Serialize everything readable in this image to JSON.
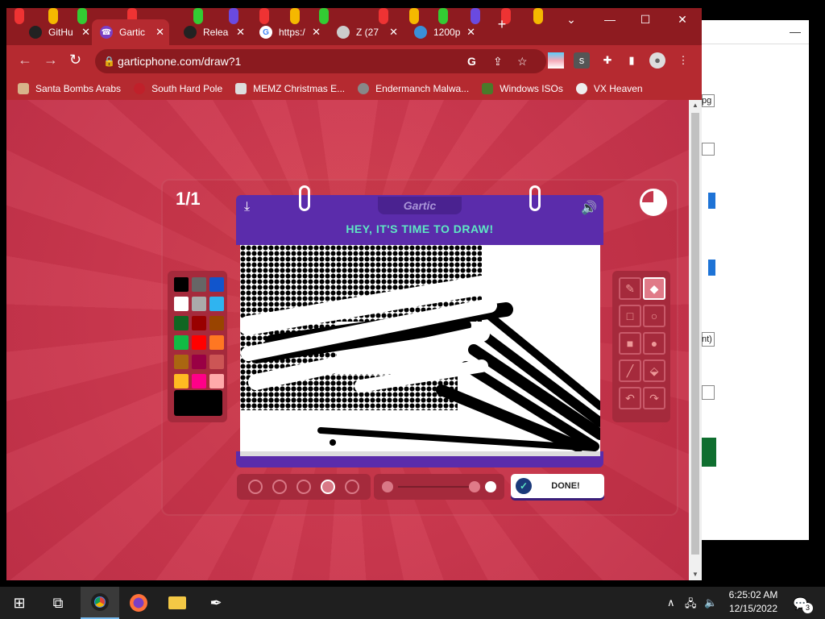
{
  "browser": {
    "tabs": [
      {
        "title": "GitHu",
        "active": false
      },
      {
        "title": "Gartic",
        "active": true
      },
      {
        "title": "Relea",
        "active": false
      },
      {
        "title": "https:/",
        "active": false
      },
      {
        "title": "Z (27",
        "active": false
      },
      {
        "title": "1200p",
        "active": false
      }
    ],
    "new_tab": "+",
    "close_glyph": "✕",
    "url": "garticphone.com/draw?1",
    "bookmarks": [
      {
        "label": "Santa Bombs Arabs",
        "icon": "figure-icon"
      },
      {
        "label": "South Hard Pole",
        "icon": "virus-icon"
      },
      {
        "label": "MEMZ Christmas E...",
        "icon": "image-icon"
      },
      {
        "label": "Endermanch Malwa...",
        "icon": "raccoon-icon"
      },
      {
        "label": "Windows ISOs",
        "icon": "tree-icon"
      },
      {
        "label": "VX Heaven",
        "icon": "skull-icon"
      }
    ]
  },
  "game": {
    "round_counter": "1/1",
    "logo": "Gartic",
    "heading": "HEY, IT'S TIME TO DRAW!",
    "done_label": "DONE!",
    "palette_colors": [
      "#000000",
      "#666666",
      "#1155cc",
      "#ffffff",
      "#aaaaaa",
      "#2fb4f0",
      "#116622",
      "#990000",
      "#994400",
      "#11bb44",
      "#ff0000",
      "#ff7722",
      "#aa6611",
      "#990044",
      "#cc5555",
      "#ffbb22",
      "#ff0088",
      "#ffaaaa"
    ],
    "selected_color": "#000000",
    "brush_sizes": 5,
    "selected_brush": 4
  },
  "taskbar": {
    "time": "6:25:02 AM",
    "date": "12/15/2022",
    "notifications": "3"
  },
  "background_window": {
    "fragments": [
      "pg",
      "nt)"
    ]
  }
}
